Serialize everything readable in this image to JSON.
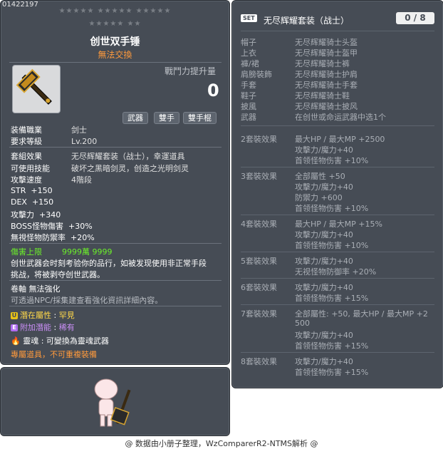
{
  "item": {
    "id": "01422197",
    "stars_row1": "★★★★★ ★★★★★ ★★★★★",
    "stars_row2": "★★★★★ ★★",
    "name": "创世双手锤",
    "tradeable": "無法交換",
    "power_label": "戰鬥力提升量",
    "power_value": "0",
    "tags": [
      "武器",
      "雙手",
      "雙手棍"
    ],
    "job_label": "装備職業",
    "job_value": "剑士",
    "level_label": "要求等級",
    "level_value": "Lv.200",
    "set_effect_label": "套組效果",
    "set_effect_value": "无尽辉耀套装（战士），幸運道具",
    "skill_label": "可使用技能",
    "skill_value": "破坏之黑暗剑灵，创造之光明剑灵",
    "speed_label": "攻擊速度",
    "speed_value": "4階段",
    "stats": [
      {
        "label": "STR",
        "value": "+150"
      },
      {
        "label": "DEX",
        "value": "+150"
      },
      {
        "label": "攻擊力",
        "value": "+340"
      },
      {
        "label": "BOSS怪物傷害",
        "value": "+30%"
      },
      {
        "label": "無視怪物防禦率",
        "value": "+20%"
      }
    ],
    "damage_cap_label": "傷害上限",
    "damage_cap_value": "9999萬 9999",
    "desc_line1": "创世武器会时刻考验你的品行，如被发现使用非正常手段",
    "desc_line2": "挑战，将被剥夺创世武器。",
    "scroll_text": "卷軸 無法強化",
    "npc_text": "可透過NPC/採集建查看強化資訊詳細內容。",
    "potential_label": "潛在屬性",
    "potential_value": "罕見",
    "bonus_label": "附加潛能",
    "bonus_value": "稀有",
    "soul_label": "靈魂",
    "soul_value": "可變換為靈魂武器",
    "exclusive_text": "專屬道具，不可重複裝備"
  },
  "set": {
    "badge": "SET",
    "title": "无尽辉耀套装（战士）",
    "count": "0 / 8",
    "pieces": [
      {
        "slot": "帽子",
        "name": "无尽辉耀骑士头盔"
      },
      {
        "slot": "上衣",
        "name": "无尽辉耀骑士盔甲"
      },
      {
        "slot": "褲/裙",
        "name": "无尽辉耀骑士裤"
      },
      {
        "slot": "肩膀裝飾",
        "name": "无尽辉耀骑士护肩"
      },
      {
        "slot": "手套",
        "name": "无尽辉耀骑士手套"
      },
      {
        "slot": "鞋子",
        "name": "无尽辉耀骑士鞋"
      },
      {
        "slot": "披風",
        "name": "无尽辉耀骑士披风"
      },
      {
        "slot": "武器",
        "name": "在创世或命运武器中选1个"
      }
    ],
    "effects": [
      {
        "label": "2套裝效果",
        "lines": [
          "最大HP / 最大MP  +2500",
          "攻擊力/魔力+40",
          "首领怪物伤害 +10%"
        ]
      },
      {
        "label": "3套裝效果",
        "lines": [
          "全部屬性 +50",
          "攻擊力/魔力+40",
          "防禦力 +600",
          "首领怪物伤害 +10%"
        ]
      },
      {
        "label": "4套裝效果",
        "lines": [
          "最大HP / 最大MP  +15%",
          "攻擊力/魔力+40",
          "首领怪物伤害 +10%"
        ]
      },
      {
        "label": "5套裝效果",
        "lines": [
          "攻擊力/魔力+40",
          "无视怪物防御率 +20%"
        ]
      },
      {
        "label": "6套裝效果",
        "lines": [
          "攻擊力/魔力+40",
          "首领怪物伤害 +15%"
        ]
      },
      {
        "label": "7套裝效果",
        "lines": [
          "全部屬性: +50, 最大HP / 最大MP  +2",
          "500",
          "攻擊力/魔力+40",
          "首领怪物伤害 +15%"
        ]
      },
      {
        "label": "8套裝效果",
        "lines": [
          "攻擊力/魔力+40",
          "首领怪物伤害 +15%"
        ]
      }
    ]
  },
  "footer": "@ 数据由小册子整理，WzComparerR2-NTMS解析 @",
  "icons": {
    "weapon": "two-handed-hammer-icon",
    "character": "character-preview-icon",
    "soul": "flame-icon",
    "potential": "u-badge-icon",
    "bonus": "e-badge-icon"
  }
}
